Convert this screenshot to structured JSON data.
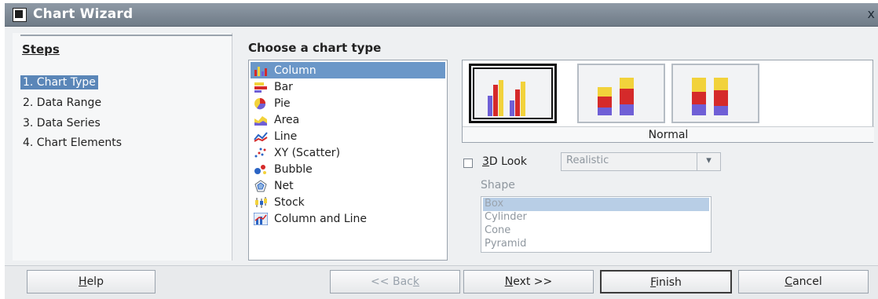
{
  "window": {
    "title": "Chart Wizard",
    "close_glyph": "x"
  },
  "steps": {
    "title": "Steps",
    "items": [
      {
        "label": "1. Chart Type",
        "active": true
      },
      {
        "label": "2. Data Range",
        "active": false
      },
      {
        "label": "3. Data Series",
        "active": false
      },
      {
        "label": "4. Chart Elements",
        "active": false
      }
    ]
  },
  "chart_type": {
    "title": "Choose a chart type",
    "types": [
      {
        "label": "Column",
        "icon": "column-chart-icon",
        "selected": true
      },
      {
        "label": "Bar",
        "icon": "bar-chart-icon",
        "selected": false
      },
      {
        "label": "Pie",
        "icon": "pie-chart-icon",
        "selected": false
      },
      {
        "label": "Area",
        "icon": "area-chart-icon",
        "selected": false
      },
      {
        "label": "Line",
        "icon": "line-chart-icon",
        "selected": false
      },
      {
        "label": "XY (Scatter)",
        "icon": "scatter-chart-icon",
        "selected": false
      },
      {
        "label": "Bubble",
        "icon": "bubble-chart-icon",
        "selected": false
      },
      {
        "label": "Net",
        "icon": "net-chart-icon",
        "selected": false
      },
      {
        "label": "Stock",
        "icon": "stock-chart-icon",
        "selected": false
      },
      {
        "label": "Column and Line",
        "icon": "column-line-chart-icon",
        "selected": false
      }
    ],
    "variants_selected_label": "Normal"
  },
  "look3d": {
    "label_pre": "",
    "label_accel": "3",
    "label_post": "D Look",
    "checked": false,
    "dropdown_value": "Realistic"
  },
  "shape": {
    "label": "Shape",
    "options": [
      "Box",
      "Cylinder",
      "Cone",
      "Pyramid"
    ],
    "selected": "Box"
  },
  "buttons": {
    "help": {
      "accel": "H",
      "rest": "elp"
    },
    "back": {
      "pre": "<< Bac",
      "accel": "k",
      "post": ""
    },
    "next": {
      "accel": "N",
      "rest": "ext >>"
    },
    "finish": {
      "accel": "F",
      "rest": "inish"
    },
    "cancel": {
      "accel": "C",
      "rest": "ancel"
    }
  },
  "colors": {
    "selection": "#6b97c8",
    "title_bar": "#7b8692",
    "bar_blue": "#6f5fd6",
    "bar_red": "#d52a2a",
    "bar_yellow": "#f2d23b"
  }
}
